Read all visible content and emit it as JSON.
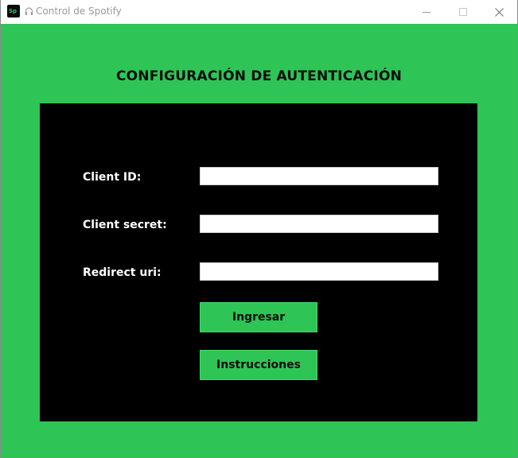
{
  "window": {
    "title": "Control de Spotify",
    "app_icon_text": "Sp"
  },
  "colors": {
    "accent_green": "#2fc456",
    "panel_black": "#000000",
    "heading_text": "#0b0b0b",
    "label_text": "#ffffff",
    "input_bg": "#ffffff"
  },
  "form": {
    "heading": "CONFIGURACIÓN DE AUTENTICACIÓN",
    "fields": [
      {
        "label": "Client ID:",
        "value": ""
      },
      {
        "label": "Client secret:",
        "value": ""
      },
      {
        "label": "Redirect uri:",
        "value": ""
      }
    ],
    "buttons": {
      "login": "Ingresar",
      "instructions": "Instrucciones"
    }
  },
  "icons": {
    "minimize": "minimize-icon",
    "maximize": "maximize-icon",
    "close": "close-icon",
    "app": "spotify-app-icon",
    "headphones": "headphones-icon"
  }
}
